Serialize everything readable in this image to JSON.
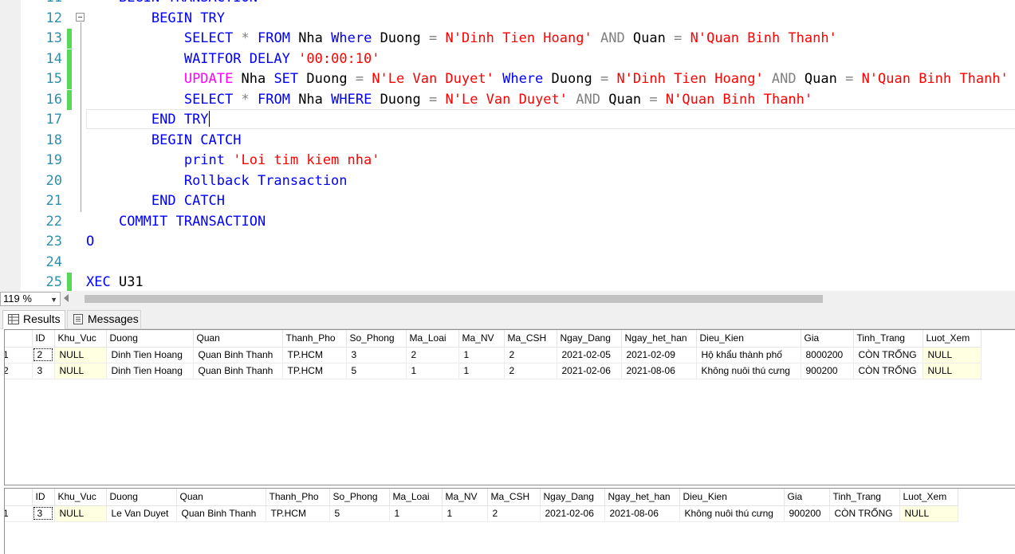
{
  "editor": {
    "lines": [
      {
        "num": "11",
        "tokens": [
          {
            "t": "    ",
            "c": "tx"
          },
          {
            "t": "BEGIN TRANSACTION",
            "c": "kw"
          }
        ]
      },
      {
        "num": "12",
        "tokens": [
          {
            "t": "        ",
            "c": "tx"
          },
          {
            "t": "BEGIN TRY",
            "c": "kw"
          }
        ]
      },
      {
        "num": "13",
        "changed": true,
        "tokens": [
          {
            "t": "            ",
            "c": "tx"
          },
          {
            "t": "SELECT",
            "c": "kw"
          },
          {
            "t": " ",
            "c": "tx"
          },
          {
            "t": "*",
            "c": "gr"
          },
          {
            "t": " ",
            "c": "tx"
          },
          {
            "t": "FROM",
            "c": "kw"
          },
          {
            "t": " Nha ",
            "c": "tx"
          },
          {
            "t": "Where",
            "c": "kw"
          },
          {
            "t": " Duong ",
            "c": "tx"
          },
          {
            "t": "=",
            "c": "gr"
          },
          {
            "t": " ",
            "c": "tx"
          },
          {
            "t": "N'Dinh Tien Hoang'",
            "c": "st"
          },
          {
            "t": " ",
            "c": "tx"
          },
          {
            "t": "AND",
            "c": "gr"
          },
          {
            "t": " Quan ",
            "c": "tx"
          },
          {
            "t": "=",
            "c": "gr"
          },
          {
            "t": " ",
            "c": "tx"
          },
          {
            "t": "N'Quan Binh Thanh'",
            "c": "st"
          }
        ]
      },
      {
        "num": "14",
        "changed": true,
        "tokens": [
          {
            "t": "            ",
            "c": "tx"
          },
          {
            "t": "WAITFOR DELAY",
            "c": "kw"
          },
          {
            "t": " ",
            "c": "tx"
          },
          {
            "t": "'00:00:10'",
            "c": "st"
          }
        ]
      },
      {
        "num": "15",
        "changed": true,
        "tokens": [
          {
            "t": "            ",
            "c": "tx"
          },
          {
            "t": "UPDATE",
            "c": "pk"
          },
          {
            "t": " Nha ",
            "c": "tx"
          },
          {
            "t": "SET",
            "c": "kw"
          },
          {
            "t": " Duong ",
            "c": "tx"
          },
          {
            "t": "=",
            "c": "gr"
          },
          {
            "t": " ",
            "c": "tx"
          },
          {
            "t": "N'Le Van Duyet'",
            "c": "st"
          },
          {
            "t": " ",
            "c": "tx"
          },
          {
            "t": "Where",
            "c": "kw"
          },
          {
            "t": " Duong ",
            "c": "tx"
          },
          {
            "t": "=",
            "c": "gr"
          },
          {
            "t": " ",
            "c": "tx"
          },
          {
            "t": "N'Dinh Tien Hoang'",
            "c": "st"
          },
          {
            "t": " ",
            "c": "tx"
          },
          {
            "t": "AND",
            "c": "gr"
          },
          {
            "t": " Quan ",
            "c": "tx"
          },
          {
            "t": "=",
            "c": "gr"
          },
          {
            "t": " ",
            "c": "tx"
          },
          {
            "t": "N'Quan Binh Thanh'",
            "c": "st"
          }
        ]
      },
      {
        "num": "16",
        "changed": true,
        "tokens": [
          {
            "t": "            ",
            "c": "tx"
          },
          {
            "t": "SELECT",
            "c": "kw"
          },
          {
            "t": " ",
            "c": "tx"
          },
          {
            "t": "*",
            "c": "gr"
          },
          {
            "t": " ",
            "c": "tx"
          },
          {
            "t": "FROM",
            "c": "kw"
          },
          {
            "t": " Nha ",
            "c": "tx"
          },
          {
            "t": "WHERE",
            "c": "kw"
          },
          {
            "t": " Duong ",
            "c": "tx"
          },
          {
            "t": "=",
            "c": "gr"
          },
          {
            "t": " ",
            "c": "tx"
          },
          {
            "t": "N'Le Van Duyet'",
            "c": "st"
          },
          {
            "t": " ",
            "c": "tx"
          },
          {
            "t": "AND",
            "c": "gr"
          },
          {
            "t": " Quan ",
            "c": "tx"
          },
          {
            "t": "=",
            "c": "gr"
          },
          {
            "t": " ",
            "c": "tx"
          },
          {
            "t": "N'Quan Binh Thanh'",
            "c": "st"
          }
        ]
      },
      {
        "num": "17",
        "caret": true,
        "tokens": [
          {
            "t": "        ",
            "c": "tx"
          },
          {
            "t": "END TRY",
            "c": "kw"
          }
        ]
      },
      {
        "num": "18",
        "tokens": [
          {
            "t": "        ",
            "c": "tx"
          },
          {
            "t": "BEGIN CATCH",
            "c": "kw"
          }
        ]
      },
      {
        "num": "19",
        "tokens": [
          {
            "t": "            ",
            "c": "tx"
          },
          {
            "t": "print",
            "c": "kw"
          },
          {
            "t": " ",
            "c": "tx"
          },
          {
            "t": "'Loi tim kiem nha'",
            "c": "st"
          }
        ]
      },
      {
        "num": "20",
        "tokens": [
          {
            "t": "            ",
            "c": "tx"
          },
          {
            "t": "Rollback Transaction",
            "c": "kw"
          }
        ]
      },
      {
        "num": "21",
        "tokens": [
          {
            "t": "        ",
            "c": "tx"
          },
          {
            "t": "END CATCH",
            "c": "kw"
          }
        ]
      },
      {
        "num": "22",
        "tokens": [
          {
            "t": "    ",
            "c": "tx"
          },
          {
            "t": "COMMIT TRANSACTION",
            "c": "kw"
          }
        ]
      },
      {
        "num": "23",
        "tokens": [
          {
            "t": "O",
            "c": "kw"
          }
        ]
      },
      {
        "num": "24",
        "tokens": []
      },
      {
        "num": "25",
        "changed": true,
        "tokens": [
          {
            "t": "XEC",
            "c": "kw"
          },
          {
            "t": " U31",
            "c": "tx"
          }
        ]
      }
    ]
  },
  "zoom": {
    "value": "119 %"
  },
  "tabs": {
    "results": "Results",
    "messages": "Messages"
  },
  "grids": [
    {
      "columns": [
        "ID",
        "Khu_Vuc",
        "Duong",
        "Quan",
        "Thanh_Pho",
        "So_Phong",
        "Ma_Loai",
        "Ma_NV",
        "Ma_CSH",
        "Ngay_Dang",
        "Ngay_het_han",
        "Dieu_Kien",
        "Gia",
        "Tinh_Trang",
        "Luot_Xem"
      ],
      "rows": [
        {
          "num": "1",
          "cells": [
            "2",
            "NULL",
            "Dinh Tien Hoang",
            "Quan Binh Thanh",
            "TP.HCM",
            "3",
            "2",
            "1",
            "2",
            "2021-02-05",
            "2021-02-09",
            "Hộ khẩu thành phố",
            "8000200",
            "CÒN TRỐNG",
            "NULL"
          ]
        },
        {
          "num": "2",
          "cells": [
            "3",
            "NULL",
            "Dinh Tien Hoang",
            "Quan Binh Thanh",
            "TP.HCM",
            "5",
            "1",
            "1",
            "2",
            "2021-02-06",
            "2021-08-06",
            "Không nuôi thú cưng",
            "900200",
            "CÒN TRỐNG",
            "NULL"
          ]
        }
      ]
    },
    {
      "columns": [
        "ID",
        "Khu_Vuc",
        "Duong",
        "Quan",
        "Thanh_Pho",
        "So_Phong",
        "Ma_Loai",
        "Ma_NV",
        "Ma_CSH",
        "Ngay_Dang",
        "Ngay_het_han",
        "Dieu_Kien",
        "Gia",
        "Tinh_Trang",
        "Luot_Xem"
      ],
      "rows": [
        {
          "num": "1",
          "cells": [
            "3",
            "NULL",
            "Le Van Duyet",
            "Quan Binh Thanh",
            "TP.HCM",
            "5",
            "1",
            "1",
            "2",
            "2021-02-06",
            "2021-08-06",
            "Không nuôi thú cưng",
            "900200",
            "CÒN TRỐNG",
            "NULL"
          ]
        }
      ]
    }
  ]
}
